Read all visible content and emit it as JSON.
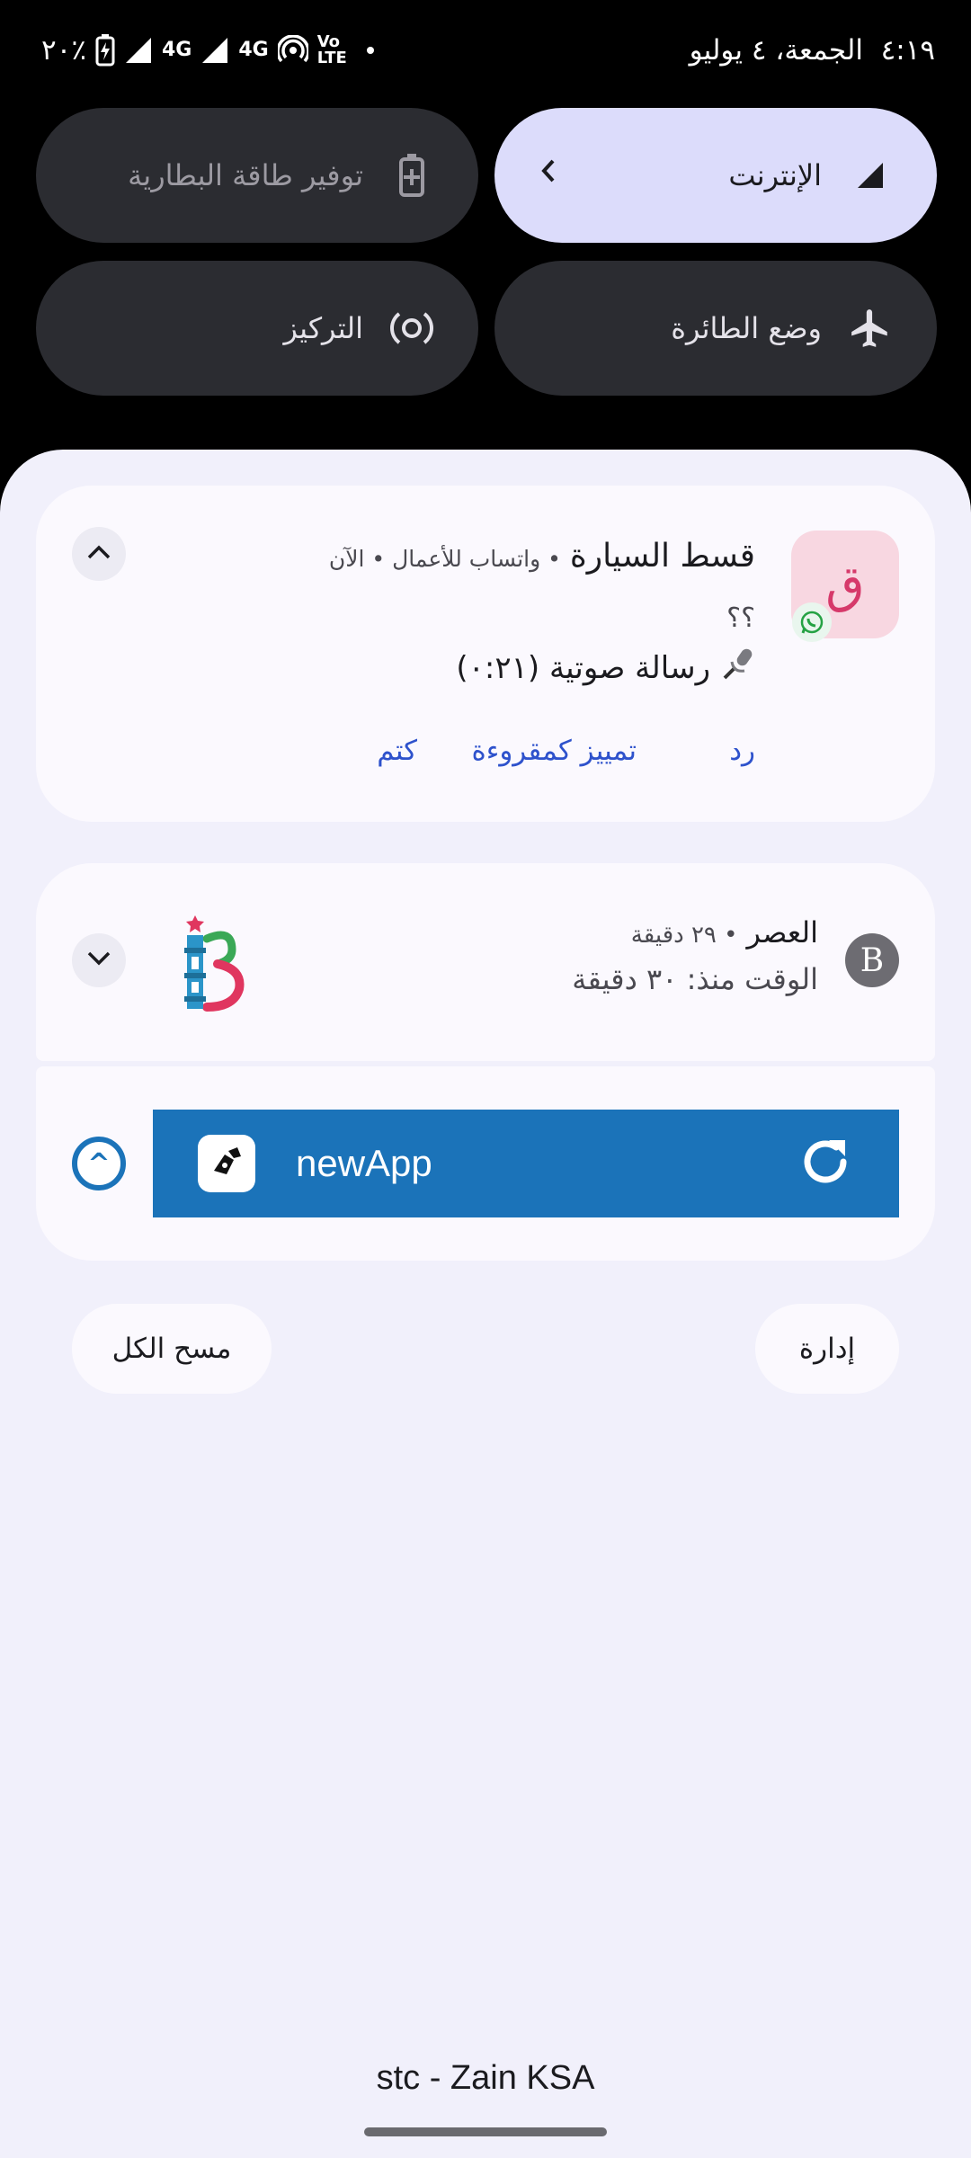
{
  "status_bar": {
    "time": "٤:١٩",
    "date": "الجمعة، ٤ يوليو",
    "battery_percent": "٢٠٪",
    "network_labels": [
      "4G",
      "4G"
    ],
    "volte_label": "Vo LTE",
    "icons": [
      "battery-charging-icon",
      "signal-icon",
      "signal-icon",
      "hotspot-icon",
      "volte-icon"
    ]
  },
  "quick_tiles": {
    "internet": {
      "label": "الإنترنت",
      "icon": "signal-icon"
    },
    "battery_saver": {
      "label": "توفير طاقة البطارية",
      "icon": "battery-icon"
    },
    "airplane": {
      "label": "وضع الطائرة",
      "icon": "airplane-icon"
    },
    "focus": {
      "label": "التركيز",
      "icon": "focus-icon"
    }
  },
  "notifications": {
    "whatsapp": {
      "avatar_letter": "ق",
      "title": "قسط السيارة",
      "meta": "• واتساب للأعمال • الآن",
      "line1": "؟؟",
      "line2": "رسالة صوتية (٠:٢١)",
      "actions": {
        "reply": "رد",
        "mark_read": "تمييز كمقروءة",
        "mute": "كتم"
      }
    },
    "prayer": {
      "icon_letter": "B",
      "title": "العصر",
      "meta": "• ٢٩ دقيقة",
      "subtitle": "الوقت منذ: ٣٠ دقيقة"
    },
    "newapp": {
      "name": "newApp",
      "ring_glyph": "^"
    }
  },
  "buttons": {
    "manage": "إدارة",
    "clear_all": "مسح الكل"
  },
  "carrier": "stc - Zain KSA",
  "colors": {
    "accent_blue": "#1b73b9",
    "action_blue": "#2e52cc",
    "shade_bg": "#f1f0fb",
    "tile_active": "#dcdcfb",
    "tile_dark": "#2b2c31"
  }
}
